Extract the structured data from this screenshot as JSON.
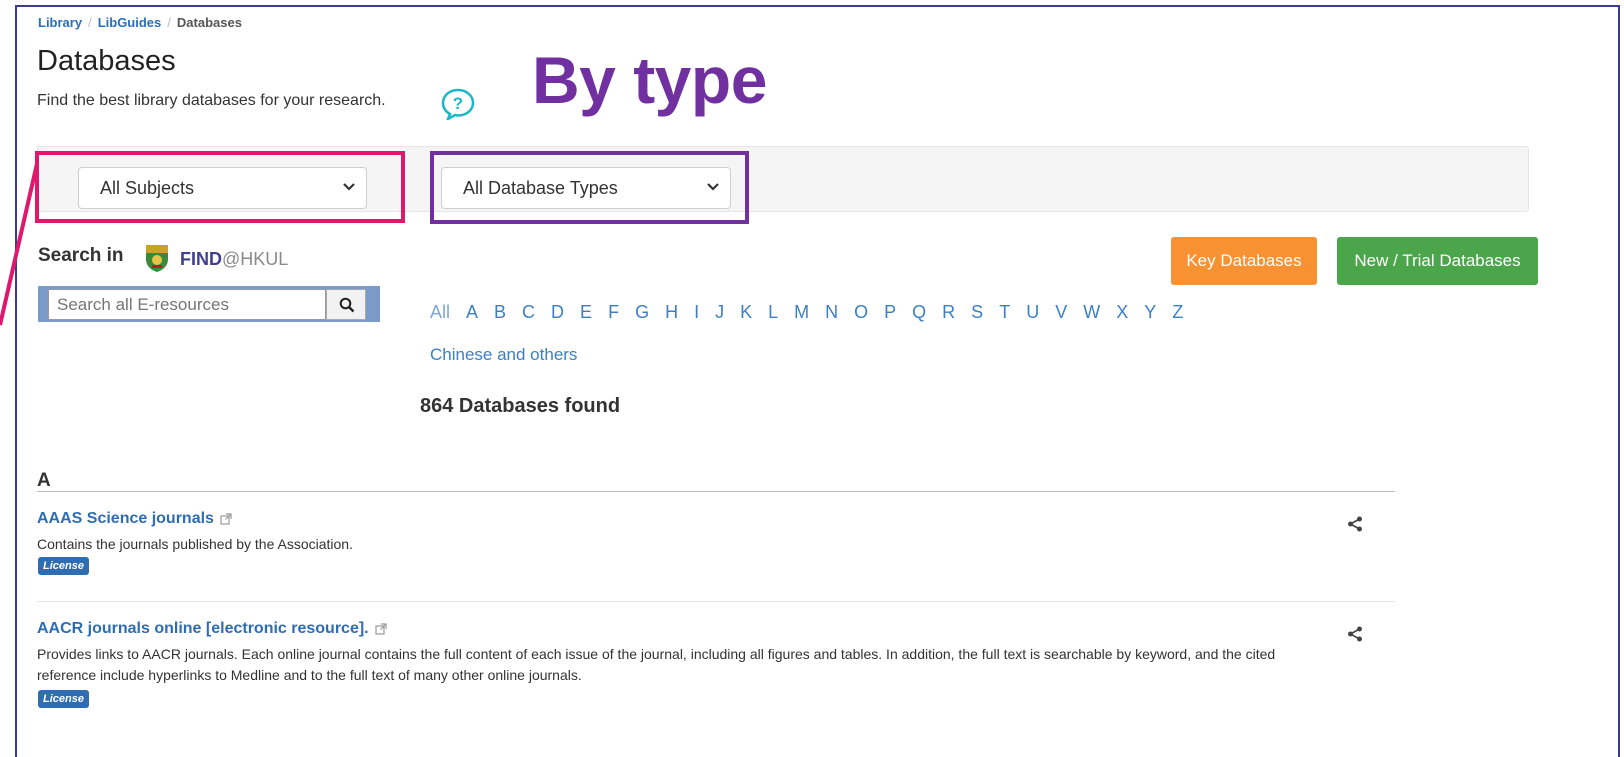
{
  "breadcrumb": {
    "library": "Library",
    "libguides": "LibGuides",
    "current": "Databases"
  },
  "header": {
    "title": "Databases",
    "subtitle": "Find the best library databases for your research.",
    "overlay_heading": "By type"
  },
  "filters": {
    "subjects": "All Subjects",
    "types": "All Database Types"
  },
  "search": {
    "label": "Search in",
    "logo_find": "FIND",
    "logo_hkul": "@HKUL",
    "placeholder": "Search all E-resources"
  },
  "buttons": {
    "key": "Key Databases",
    "new_trial": "New / Trial Databases"
  },
  "az": {
    "all": "All",
    "letters": [
      "A",
      "B",
      "C",
      "D",
      "E",
      "F",
      "G",
      "H",
      "I",
      "J",
      "K",
      "L",
      "M",
      "N",
      "O",
      "P",
      "Q",
      "R",
      "S",
      "T",
      "U",
      "V",
      "W",
      "X",
      "Y",
      "Z"
    ],
    "chinese": "Chinese and others"
  },
  "results": {
    "found": "864 Databases found",
    "letter": "A"
  },
  "entries": [
    {
      "title": "AAAS Science journals",
      "desc": "Contains the journals published by the Association.",
      "badge": "License"
    },
    {
      "title": "AACR journals online [electronic resource].",
      "desc": "Provides links to AACR journals. Each online journal contains the full content of each issue of the journal, including all figures and tables. In addition, the full text is searchable by keyword, and the cited reference include hyperlinks to Medline and to the full text of many other online journals.",
      "badge": "License"
    }
  ],
  "colors": {
    "highlight_subjects": "#e0186c",
    "highlight_types": "#7030a0",
    "key_button": "#f89131",
    "new_button": "#4ba54b",
    "link": "#2f6db3"
  }
}
